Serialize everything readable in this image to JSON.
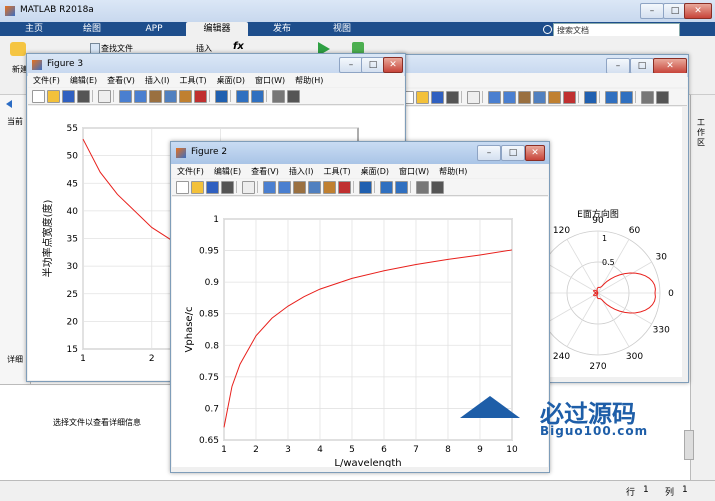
{
  "app": {
    "title": "MATLAB R2018a"
  },
  "ribbon": {
    "tabs": [
      {
        "label": "主页"
      },
      {
        "label": "绘图"
      },
      {
        "label": "APP"
      },
      {
        "label": "编辑器"
      },
      {
        "label": "发布"
      },
      {
        "label": "视图"
      }
    ],
    "search_placeholder": "搜索文档",
    "new_label": "新建",
    "find_file_label": "查找文件",
    "insert_label": "插入",
    "fx_label": "fx"
  },
  "left_panel": {
    "current_label": "当前",
    "detail_label": "详细",
    "select_file_hint": "选择文件以查看详细信息"
  },
  "workspace_tab": "工作区",
  "statusbar": {
    "row_label": "行",
    "row_value": "1",
    "col_label": "列",
    "col_value": "1"
  },
  "figure_menu": [
    "文件(F)",
    "编辑(E)",
    "查看(V)",
    "插入(I)",
    "工具(T)",
    "桌面(D)",
    "窗口(W)",
    "帮助(H)"
  ],
  "figures": {
    "fig3": {
      "title": "Figure 3",
      "ylabel": "半功率点宽度(度)"
    },
    "fig1": {
      "title": "E面方向图"
    },
    "fig2": {
      "title": "Figure 2",
      "xlabel": "L/wavelength",
      "ylabel": "Vphase/c"
    }
  },
  "watermark": {
    "site": "必过源码",
    "url": "Biguo100.com"
  },
  "colors": {
    "ribbon": "#1e4e8c",
    "line": "#e8201c",
    "accent": "#2b7bd4"
  },
  "chart_data": [
    {
      "type": "line",
      "id": "fig3",
      "title": "",
      "xlabel": "",
      "ylabel": "半功率点宽度(度)",
      "xlim": [
        1,
        5
      ],
      "ylim": [
        15,
        55
      ],
      "xticks": [
        1,
        2,
        3
      ],
      "yticks": [
        15,
        20,
        25,
        30,
        35,
        40,
        45,
        50,
        55
      ],
      "series": [
        {
          "x": [
            1,
            1.25,
            1.5,
            2,
            2.5,
            3,
            3.5,
            4,
            4.3
          ],
          "values": [
            53,
            47,
            43,
            37,
            33,
            30,
            28,
            26.5,
            25.5
          ]
        }
      ]
    },
    {
      "type": "line",
      "id": "fig2",
      "title": "",
      "xlabel": "L/wavelength",
      "ylabel": "Vphase/c",
      "xlim": [
        1,
        10
      ],
      "ylim": [
        0.65,
        1
      ],
      "xticks": [
        1,
        2,
        3,
        4,
        5,
        6,
        7,
        8,
        9,
        10
      ],
      "yticks": [
        0.65,
        0.7,
        0.75,
        0.8,
        0.85,
        0.9,
        0.95,
        1
      ],
      "series": [
        {
          "x": [
            1,
            1.25,
            1.5,
            2,
            2.5,
            3,
            3.5,
            4,
            5,
            6,
            7,
            8,
            9,
            10
          ],
          "values": [
            0.67,
            0.735,
            0.77,
            0.815,
            0.843,
            0.862,
            0.877,
            0.889,
            0.906,
            0.918,
            0.928,
            0.936,
            0.943,
            0.951
          ]
        }
      ]
    },
    {
      "type": "polar",
      "id": "fig1",
      "title": "E面方向图",
      "angle_ticks": [
        "90",
        "60",
        "30",
        "0",
        "330",
        "300",
        "270",
        "240",
        "210",
        "180",
        "150",
        "120"
      ],
      "radius_ticks": [
        "0.5",
        "1"
      ]
    }
  ]
}
